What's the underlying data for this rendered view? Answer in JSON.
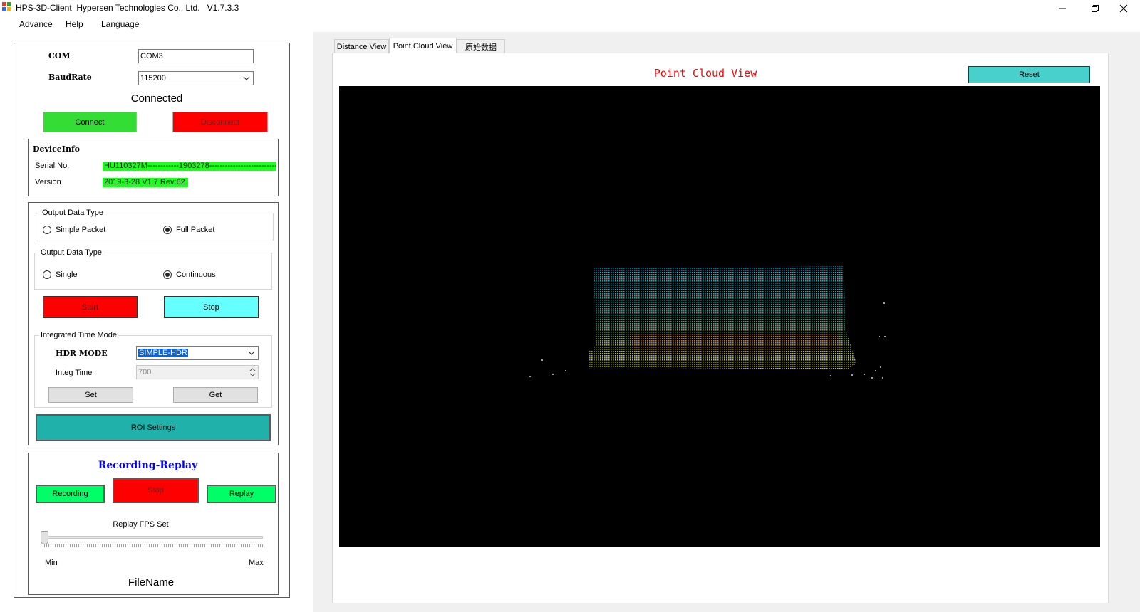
{
  "window": {
    "title": "HPS-3D-Client  Hypersen Technologies Co., Ltd.   V1.7.3.3",
    "controls": {
      "minimize_icon": "minimize-icon",
      "restore_icon": "restore-icon",
      "close_icon": "close-icon"
    }
  },
  "menu": {
    "items": [
      "Advance",
      "Help",
      "Language"
    ]
  },
  "connection": {
    "com_label": "COM",
    "com_value": "COM3",
    "baud_label": "BaudRate",
    "baud_value": "115200",
    "status": "Connected",
    "connect_label": "Connect",
    "disconnect_label": "Disconnect"
  },
  "device_info": {
    "title": "DeviceInfo",
    "serial_label": "Serial No.",
    "serial_value": "HU110327M------------1903278--------------------------",
    "version_label": "Version",
    "version_value": "2019-3-28  V1.7 Rev:62"
  },
  "output_packet": {
    "legend": "Output Data Type",
    "option1": "Simple Packet",
    "option2": "Full Packet",
    "selected": "Full Packet"
  },
  "output_mode": {
    "legend": "Output Data Type",
    "option1": "Single",
    "option2": "Continuous",
    "selected": "Continuous"
  },
  "acquisition": {
    "start_label": "Start",
    "stop_label": "Stop"
  },
  "integ": {
    "legend": "Integrated Time Mode",
    "hdr_label": "HDR MODE",
    "hdr_value": "SIMPLE-HDR",
    "integ_label": "Integ Time",
    "integ_value": "700",
    "set_label": "Set",
    "get_label": "Get"
  },
  "roi_label": "ROI Settings",
  "recording": {
    "title": "Recording-Replay",
    "recording_label": "Recording",
    "stop_label": "Stop",
    "replay_label": "Replay",
    "fps_label": "Replay FPS Set",
    "fps_level": 0,
    "min_label": "Min",
    "max_label": "Max",
    "filename_label": "FileName"
  },
  "tabs": [
    "Distance View",
    "Point Cloud View",
    "原始数据"
  ],
  "active_tab": "Point Cloud View",
  "viewer": {
    "title": "Point Cloud View",
    "reset_label": "Reset"
  },
  "colors": {
    "green_button": "#33dd33",
    "red_button": "#ff0000",
    "cyan_button": "#66ffff",
    "teal_button": "#20b2aa",
    "replay_green": "#00ff66",
    "reset_teal": "#48d1cc",
    "viewport_bg": "#000000",
    "highlight_green": "#1cff1c",
    "title_red": "#ff0000",
    "recording_title_blue": "#0000ff"
  }
}
